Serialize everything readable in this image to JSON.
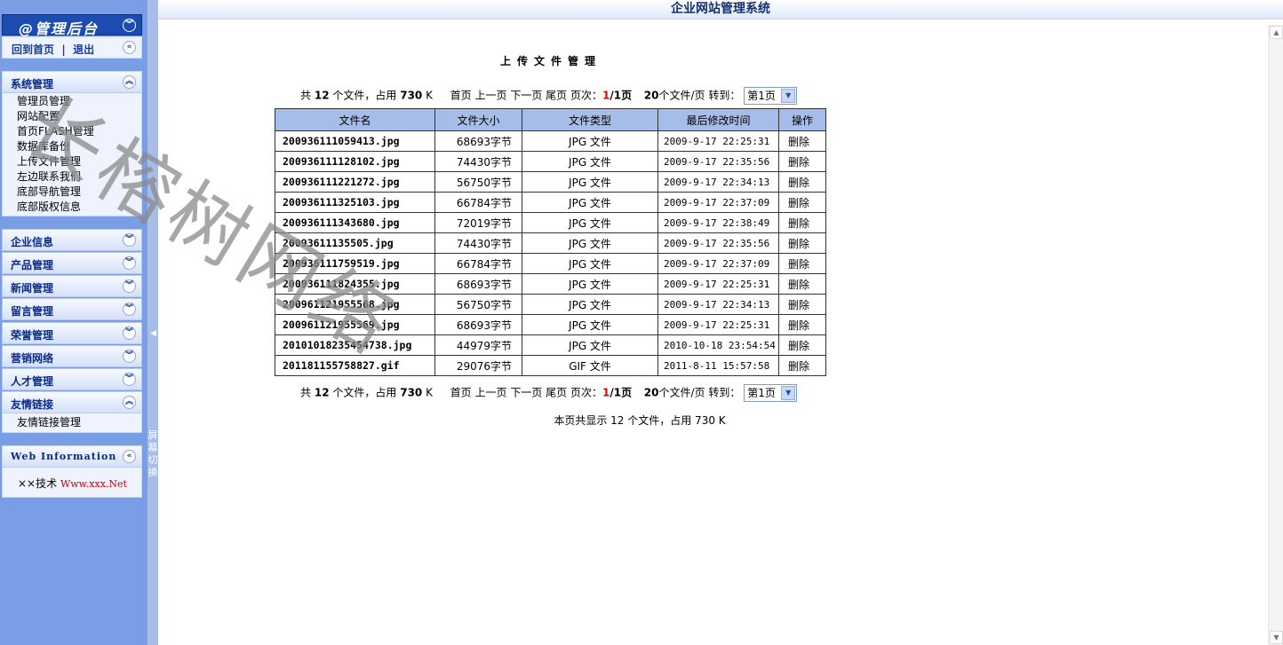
{
  "sidebar": {
    "brand": "@管理后台",
    "home_link": "回到首页",
    "separator": "|",
    "logout_link": "退出",
    "system_section": {
      "title": "系统管理",
      "items": [
        "管理员管理",
        "网站配置",
        "首页FLASH管理",
        "数据库备份",
        "上传文件管理",
        "左边联系我们",
        "底部导航管理",
        "底部版权信息"
      ]
    },
    "collapsed_sections": [
      "企业信息",
      "产品管理",
      "新闻管理",
      "留言管理",
      "荣誉管理",
      "营销网络",
      "人才管理"
    ],
    "links_section": {
      "title": "友情链接",
      "items": [
        "友情链接管理"
      ]
    },
    "web_info": {
      "title": "Web Information",
      "tech_label": "××技术",
      "site": "Www.xxx.Net"
    },
    "screen_switch": "屏幕切换"
  },
  "header": {
    "title": "企业网站管理系统"
  },
  "page": {
    "title": "上传文件管理",
    "pager": {
      "total_prefix": "共",
      "file_count": "12",
      "files_occupy": "个文件，占用",
      "size": "730",
      "size_unit": "K",
      "first": "首页",
      "prev": "上一页",
      "next": "下一页",
      "last": "尾页",
      "page_label": "页次：",
      "current_page": "1",
      "total_pages": "/1页",
      "per_page": "20",
      "per_page_suffix": "个文件/页",
      "goto": "转到：",
      "select_value": "第1页"
    },
    "table": {
      "headers": [
        "文件名",
        "文件大小",
        "文件类型",
        "最后修改时间",
        "操作"
      ],
      "rows": [
        [
          "200936111059413.jpg",
          "68693字节",
          "JPG 文件",
          "2009-9-17 22:25:31",
          "删除"
        ],
        [
          "200936111128102.jpg",
          "74430字节",
          "JPG 文件",
          "2009-9-17 22:35:56",
          "删除"
        ],
        [
          "200936111221272.jpg",
          "56750字节",
          "JPG 文件",
          "2009-9-17 22:34:13",
          "删除"
        ],
        [
          "200936111325103.jpg",
          "66784字节",
          "JPG 文件",
          "2009-9-17 22:37:09",
          "删除"
        ],
        [
          "200936111343680.jpg",
          "72019字节",
          "JPG 文件",
          "2009-9-17 22:38:49",
          "删除"
        ],
        [
          "20093611135505.jpg",
          "74430字节",
          "JPG 文件",
          "2009-9-17 22:35:56",
          "删除"
        ],
        [
          "200936111759519.jpg",
          "66784字节",
          "JPG 文件",
          "2009-9-17 22:37:09",
          "删除"
        ],
        [
          "200936111824355.jpg",
          "68693字节",
          "JPG 文件",
          "2009-9-17 22:25:31",
          "删除"
        ],
        [
          "200961121955568.jpg",
          "56750字节",
          "JPG 文件",
          "2009-9-17 22:34:13",
          "删除"
        ],
        [
          "200961121955569.jpg",
          "68693字节",
          "JPG 文件",
          "2009-9-17 22:25:31",
          "删除"
        ],
        [
          "20101018235454738.jpg",
          "44979字节",
          "JPG 文件",
          "2010-10-18 23:54:54",
          "删除"
        ],
        [
          "201181155758827.gif",
          "29076字节",
          "GIF 文件",
          "2011-8-11 15:57:58",
          "删除"
        ]
      ]
    },
    "summary": "本页共显示 12 个文件，占用 730 K"
  },
  "watermark": "长榕树网络"
}
